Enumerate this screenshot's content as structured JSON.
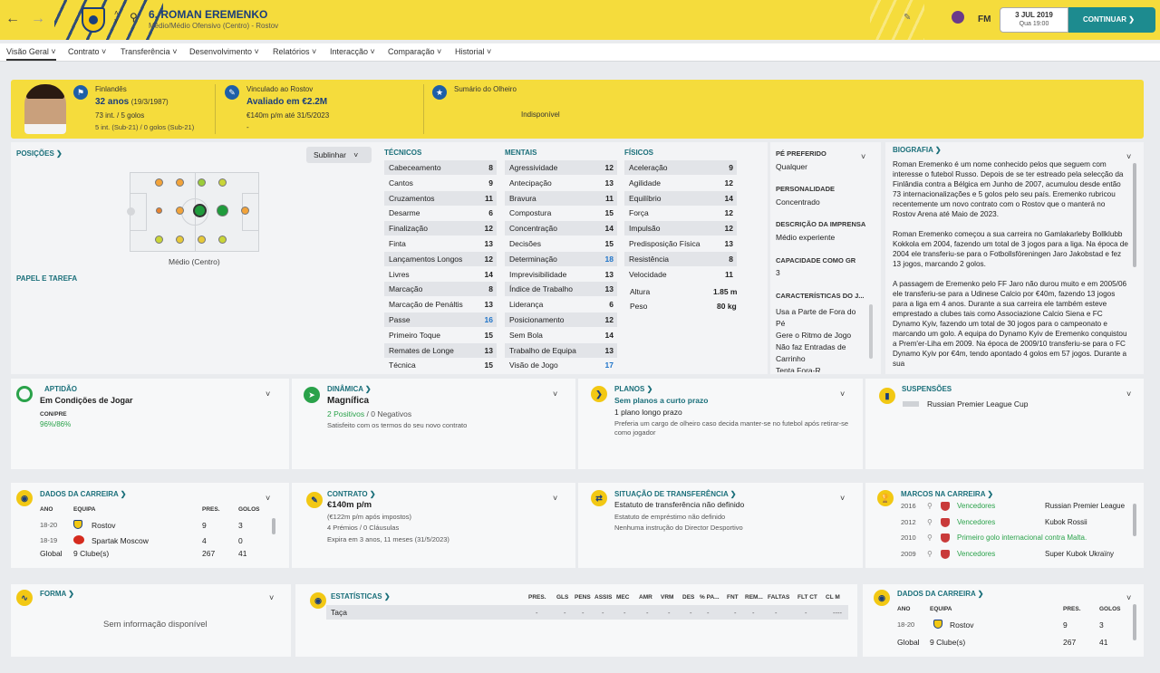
{
  "header": {
    "name": "6. ROMAN EREMENKO",
    "subtitle": "Médio/Médio Ofensivo (Centro) - Rostov",
    "date": "3 JUL 2019",
    "day_time": "Qua 19:00",
    "continue": "CONTINUAR",
    "fm": "FM"
  },
  "tabs": [
    "Visão Geral",
    "Contrato",
    "Transferência",
    "Desenvolvimento",
    "Relatórios",
    "Interacção",
    "Comparação",
    "Historial"
  ],
  "banner": {
    "nationality": "Finlandês",
    "age": "32 anos",
    "dob": "(19/3/1987)",
    "caps": "73 int. / 5 golos",
    "u21": "5 int. (Sub-21) / 0 golos (Sub-21)",
    "contract_club": "Vinculado ao Rostov",
    "value": "Avaliado em €2.2M",
    "wage": "€140m p/m até 31/5/2023",
    "dash": "-",
    "scout_title": "Sumário do Olheiro",
    "scout_value": "Indisponível"
  },
  "positions": {
    "title": "POSIÇÕES",
    "role_title": "PAPEL E TAREFA",
    "pos_label": "Médio (Centro)",
    "highlight": "Sublinhar"
  },
  "technical": {
    "title": "TÉCNICOS",
    "items": [
      [
        "Cabeceamento",
        "8"
      ],
      [
        "Cantos",
        "9"
      ],
      [
        "Cruzamentos",
        "11"
      ],
      [
        "Desarme",
        "6"
      ],
      [
        "Finalização",
        "12"
      ],
      [
        "Finta",
        "13"
      ],
      [
        "Lançamentos Longos",
        "12"
      ],
      [
        "Livres",
        "14"
      ],
      [
        "Marcação",
        "8"
      ],
      [
        "Marcação de Penáltis",
        "13"
      ],
      [
        "Passe",
        "16"
      ],
      [
        "Primeiro Toque",
        "15"
      ],
      [
        "Remates de Longe",
        "13"
      ],
      [
        "Técnica",
        "15"
      ]
    ]
  },
  "mental": {
    "title": "MENTAIS",
    "items": [
      [
        "Agressividade",
        "12"
      ],
      [
        "Antecipação",
        "13"
      ],
      [
        "Bravura",
        "11"
      ],
      [
        "Compostura",
        "15"
      ],
      [
        "Concentração",
        "14"
      ],
      [
        "Decisões",
        "15"
      ],
      [
        "Determinação",
        "18"
      ],
      [
        "Imprevisibilidade",
        "13"
      ],
      [
        "Índice de Trabalho",
        "13"
      ],
      [
        "Liderança",
        "6"
      ],
      [
        "Posicionamento",
        "12"
      ],
      [
        "Sem Bola",
        "14"
      ],
      [
        "Trabalho de Equipa",
        "13"
      ],
      [
        "Visão de Jogo",
        "17"
      ]
    ]
  },
  "physical": {
    "title": "FÍSICOS",
    "items": [
      [
        "Aceleração",
        "9"
      ],
      [
        "Agilidade",
        "12"
      ],
      [
        "Equilíbrio",
        "14"
      ],
      [
        "Força",
        "12"
      ],
      [
        "Impulsão",
        "12"
      ],
      [
        "Predisposição Física",
        "13"
      ],
      [
        "Resistência",
        "8"
      ],
      [
        "Velocidade",
        "11"
      ]
    ],
    "height_label": "Altura",
    "height": "1.85 m",
    "weight_label": "Peso",
    "weight": "80 kg"
  },
  "info": {
    "foot_title": "PÉ PREFERIDO",
    "foot": "Qualquer",
    "pers_title": "PERSONALIDADE",
    "pers": "Concentrado",
    "press_title": "DESCRIÇÃO DA IMPRENSA",
    "press": "Médio experiente",
    "gk_title": "CAPACIDADE COMO GR",
    "gk": "3",
    "traits_title": "CARACTERÍSTICAS DO J...",
    "traits": [
      "Usa a Parte de Fora do Pé",
      "Gere o Ritmo de Jogo",
      "Não faz Entradas de Carrinho",
      "Tenta Fora-R..."
    ]
  },
  "bio": {
    "title": "BIOGRAFIA",
    "p1": "Roman Eremenko é um nome conhecido pelos que seguem com interesse o futebol Russo. Depois de se ter estreado pela selecção da Finlândia contra a Bélgica em Junho de 2007, acumulou desde então 73 internacionalizações e 5 golos pelo seu país. Eremenko rubricou recentemente um novo contrato com o Rostov que o manterá no Rostov Arena até Maio de 2023.",
    "p2": "Roman Eremenko começou a sua carreira no Gamlakarleby Bollklubb Kokkola em 2004, fazendo um total de 3 jogos para a liga. Na época de 2004 ele transferiu-se para o Fotbollsföreningen Jaro Jakobstad e fez 13 jogos, marcando 2 golos.",
    "p3": "A passagem de Eremenko pelo FF Jaro não durou muito e em 2005/06 ele transferiu-se para a Udinese Calcio por €40m, fazendo 13 jogos para a liga em 4 anos. Durante a sua carreira ele também esteve emprestado a clubes tais como Associazione Calcio Siena e FC Dynamo Kyiv, fazendo um total de 30 jogos para o campeonato e marcando um golo. A equipa do Dynamo Kyiv de Eremenko conquistou a Prem'er-Liha em 2009. Na época de 2009/10 transferiu-se para o FC Dynamo Kyiv por €4m, tendo apontado 4 golos em 57 jogos. Durante a sua"
  },
  "fitness": {
    "title": "APTIDÃO",
    "value": "Em Condições de Jogar",
    "cp_label": "CON/PRE",
    "cp": "96%/86%"
  },
  "dynamics": {
    "title": "DINÂMICA",
    "value": "Magnífica",
    "pos": "2 Positivos",
    "neg": "0 Negativos",
    "note": "Satisfeito com os termos do seu novo contrato"
  },
  "plans": {
    "title": "PLANOS",
    "value": "Sem planos a curto prazo",
    "long": "1 plano longo prazo",
    "note": "Preferia um cargo de olheiro caso decida manter-se no futebol após retirar-se como jogador"
  },
  "susp": {
    "title": "SUSPENSÕES",
    "value": "Russian Premier League Cup"
  },
  "career": {
    "title": "DADOS DA CARREIRA",
    "headers": [
      "ANO",
      "EQUIPA",
      "PRES.",
      "GOLOS"
    ],
    "rows": [
      [
        "18-20",
        "Rostov",
        "9",
        "3"
      ],
      [
        "18-19",
        "Spartak Moscow",
        "4",
        "0"
      ],
      [
        "Global",
        "9 Clube(s)",
        "267",
        "41"
      ]
    ]
  },
  "contract": {
    "title": "CONTRATO",
    "wage": "€140m p/m",
    "net": "(€122m p/m após impostos)",
    "bonus": "4 Prémios / 0 Cláusulas",
    "expires": "Expira em 3 anos, 11 meses (31/5/2023)"
  },
  "transfer": {
    "title": "SITUAÇÃO DE TRANSFERÊNCIA",
    "status": "Estatuto de transferência não definido",
    "loan": "Estatuto de empréstimo não definido",
    "dir": "Nenhuma instrução do Director Desportivo"
  },
  "milestones": {
    "title": "MARCOS NA CARREIRA",
    "rows": [
      [
        "2016",
        "Vencedores",
        "Russian Premier League"
      ],
      [
        "2012",
        "Vencedores",
        "Kubok Rossii"
      ],
      [
        "2010",
        "Primeiro golo internacional contra Malta.",
        ""
      ],
      [
        "2009",
        "Vencedores",
        "Super Kubok Ukraïny"
      ]
    ]
  },
  "form": {
    "title": "FORMA",
    "empty": "Sem informação disponível"
  },
  "stats": {
    "title": "ESTATÍSTICAS",
    "headers": [
      "PRES.",
      "GLS",
      "PENS",
      "ASSIS",
      "MEC",
      "AMR",
      "VRM",
      "DES",
      "% PA...",
      "FNT",
      "REM...",
      "FALTAS",
      "FLT CT",
      "CL M"
    ],
    "row_label": "Taça",
    "dash": "-",
    "dash2": "----"
  },
  "career2": {
    "title": "DADOS DA CARREIRA",
    "headers": [
      "ANO",
      "EQUIPA",
      "PRES.",
      "GOLOS"
    ],
    "rows": [
      [
        "18-20",
        "Rostov",
        "9",
        "3"
      ],
      [
        "Global",
        "9 Clube(s)",
        "267",
        "41"
      ]
    ]
  },
  "colors": {
    "header": "#f5dc3c",
    "accent": "#1d8b8f",
    "navy": "#1a3d7c"
  }
}
